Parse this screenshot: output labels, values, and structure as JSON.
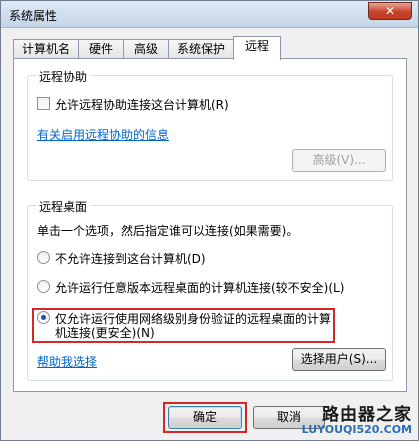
{
  "window": {
    "title": "系统属性",
    "close_glyph": "✕"
  },
  "tabs": [
    {
      "label": "计算机名"
    },
    {
      "label": "硬件"
    },
    {
      "label": "高级"
    },
    {
      "label": "系统保护"
    },
    {
      "label": "远程",
      "active": true
    }
  ],
  "remote_assistance": {
    "title": "远程协助",
    "allow_label": "允许远程协助连接这台计算机(R)",
    "allow_checked": false,
    "info_link": "有关启用远程协助的信息",
    "advanced_button": "高级(V)..."
  },
  "remote_desktop": {
    "title": "远程桌面",
    "instruction": "单击一个选项，然后指定谁可以连接(如果需要)。",
    "options": [
      {
        "label": "不允许连接到这台计算机(D)",
        "checked": false
      },
      {
        "label": "允许运行任意版本远程桌面的计算机连接(较不安全)(L)",
        "checked": false
      },
      {
        "label_line1": "仅允许运行使用网络级别身份验证的远程桌面的计算",
        "label_line2": "机连接(更安全)(N)",
        "checked": true
      }
    ],
    "help_link": "帮助我选择",
    "select_users_button": "选择用户(S)..."
  },
  "footer": {
    "ok_button": "确定",
    "cancel_button": "取消"
  },
  "watermark": {
    "line1": "路由器之家",
    "line2": "LUYOUQI520.COM"
  }
}
